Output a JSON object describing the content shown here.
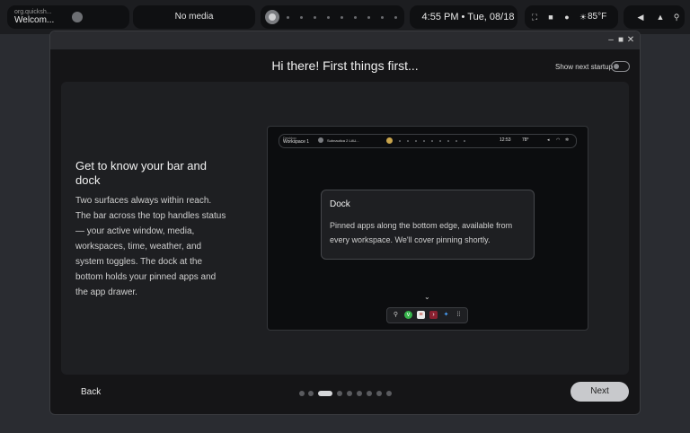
{
  "topbar": {
    "app_subtitle": "org.quicksh...",
    "app_title": "Welcom...",
    "media": "No media",
    "clock": "4:55 PM • Tue, 08/18",
    "temperature": "85°F",
    "icons": [
      "app-icon",
      "workspace-active",
      "fullscreen-icon",
      "camera-icon",
      "microphone-icon",
      "weather-sun-icon",
      "speaker-icon",
      "notification-bell-icon",
      "network-icon"
    ]
  },
  "window": {
    "heading": "Hi there! First things first...",
    "show_startup_label": "Show next startup",
    "show_startup_on": false
  },
  "step": {
    "title": "Get to know your bar and dock",
    "body": "Two surfaces always within reach. The bar across the top handles status — your active window, media, workspaces, time, weather, and system toggles. The dock at the bottom holds your pinned apps and the app drawer."
  },
  "preview": {
    "bar": {
      "label_small": "Desktop",
      "label": "Workspace 1",
      "media": "Subnautica 2 LAU...",
      "clock": "12:53",
      "weather": "78°"
    },
    "tip": {
      "title": "Dock",
      "text": "Pinned apps along the bottom edge, available from every workspace. We'll cover pinning shortly."
    },
    "dock_apps": [
      "pin-icon",
      "shield-app-icon",
      "document-app-icon",
      "terminal-app-icon",
      "star-app-icon",
      "app-drawer-icon"
    ]
  },
  "footer": {
    "back_label": "Back",
    "next_label": "Next",
    "page_count": 10,
    "current_page": 3
  },
  "colors": {
    "accent": "#c8c9cc",
    "background": "#151517"
  }
}
